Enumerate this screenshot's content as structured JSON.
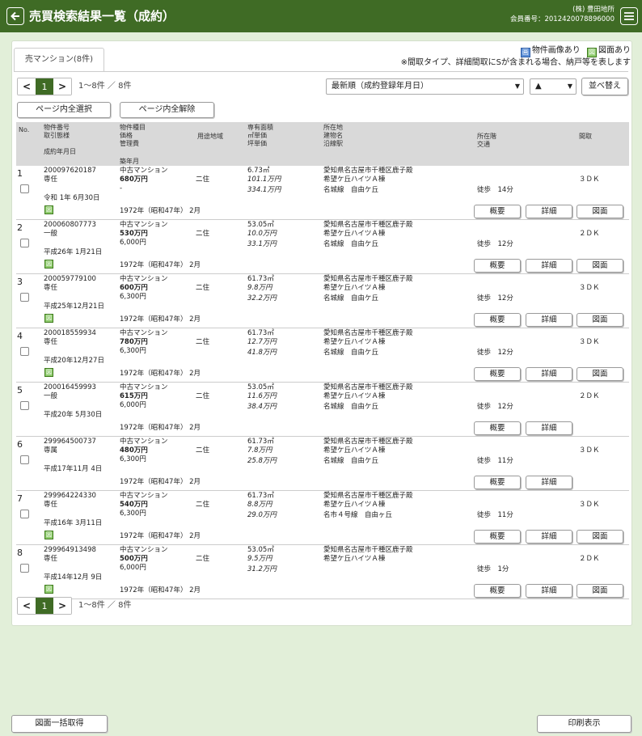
{
  "header": {
    "title": "売買検索結果一覧（成約）",
    "company": "(株) 豊田地所",
    "member_no": "会員番号：2012420078896000"
  },
  "tab": {
    "label": "売マンション(8件)"
  },
  "legend": {
    "photo_label": "物件画像あり",
    "plan_label": "図面あり",
    "note": "※間取タイプ、詳細間取にSが含まれる場合、納戸等を表します",
    "photo_icon": "画",
    "plan_icon": "図"
  },
  "pager": {
    "prev": "<",
    "current": "1",
    "next": ">",
    "range": "1～8件 ／ 8件"
  },
  "sort": {
    "selected": "最新順（成約登録年月日）",
    "direction": "▲",
    "button": "並べ替え"
  },
  "buttons": {
    "select_all": "ページ内全選択",
    "clear_all": "ページ内全解除"
  },
  "table_headers": {
    "no": "No.",
    "col1": [
      "物件番号",
      "取引態様",
      "",
      "成約年月日"
    ],
    "col2": [
      "物件種目",
      "価格",
      "管理費",
      "",
      "",
      "築年月"
    ],
    "col3": [
      "用途地域"
    ],
    "col4": [
      "専有面積",
      "㎡単価",
      "坪単価"
    ],
    "col5": [
      "所在地",
      "建物名",
      "沿線駅"
    ],
    "col6": [
      "所在階",
      "交通"
    ],
    "col7": [
      "間取"
    ]
  },
  "row_buttons": {
    "summary": "概要",
    "detail": "詳細",
    "plan": "図面"
  },
  "rows": [
    {
      "no": "1",
      "id": "200097620187",
      "mode": "専任",
      "date": "令和 1年 6月30日",
      "type": "中古マンション",
      "price": "680万円",
      "fee": "-",
      "built": "1972年（昭和47年） 2月",
      "zone": "二住",
      "area": "6.73㎡",
      "m2price": "101.1万円",
      "tsubo": "334.1万円",
      "addr": "愛知県名古屋市千種区鹿子殿",
      "bldg": "希望ケ丘ハイツＡ棟",
      "line": "名城線　自由ケ丘",
      "access": "徒歩　14分",
      "layout": "３ＤＫ",
      "plan": true
    },
    {
      "no": "2",
      "id": "200060807773",
      "mode": "一般",
      "date": "平成26年 1月21日",
      "type": "中古マンション",
      "price": "530万円",
      "fee": "6,000円",
      "built": "1972年（昭和47年） 2月",
      "zone": "二住",
      "area": "53.05㎡",
      "m2price": "10.0万円",
      "tsubo": "33.1万円",
      "addr": "愛知県名古屋市千種区鹿子殿",
      "bldg": "希望ケ丘ハイツＡ棟",
      "line": "名城線　自由ケ丘",
      "access": "徒歩　12分",
      "layout": "２ＤＫ",
      "plan": true
    },
    {
      "no": "3",
      "id": "200059779100",
      "mode": "専任",
      "date": "平成25年12月21日",
      "type": "中古マンション",
      "price": "600万円",
      "fee": "6,300円",
      "built": "1972年（昭和47年） 2月",
      "zone": "二住",
      "area": "61.73㎡",
      "m2price": "9.8万円",
      "tsubo": "32.2万円",
      "addr": "愛知県名古屋市千種区鹿子殿",
      "bldg": "希望ケ丘ハイツＡ棟",
      "line": "名城線　自由ケ丘",
      "access": "徒歩　12分",
      "layout": "３ＤＫ",
      "plan": true
    },
    {
      "no": "4",
      "id": "200018559934",
      "mode": "専任",
      "date": "平成20年12月27日",
      "type": "中古マンション",
      "price": "780万円",
      "fee": "6,300円",
      "built": "1972年（昭和47年） 2月",
      "zone": "二住",
      "area": "61.73㎡",
      "m2price": "12.7万円",
      "tsubo": "41.8万円",
      "addr": "愛知県名古屋市千種区鹿子殿",
      "bldg": "希望ケ丘ハイツＡ棟",
      "line": "名城線　自由ケ丘",
      "access": "徒歩　12分",
      "layout": "３ＤＫ",
      "plan": true
    },
    {
      "no": "5",
      "id": "200016459993",
      "mode": "一般",
      "date": "平成20年 5月30日",
      "type": "中古マンション",
      "price": "615万円",
      "fee": "6,000円",
      "built": "1972年（昭和47年） 2月",
      "zone": "二住",
      "area": "53.05㎡",
      "m2price": "11.6万円",
      "tsubo": "38.4万円",
      "addr": "愛知県名古屋市千種区鹿子殿",
      "bldg": "希望ケ丘ハイツＡ棟",
      "line": "名城線　自由ケ丘",
      "access": "徒歩　12分",
      "layout": "２ＤＫ",
      "plan": false
    },
    {
      "no": "6",
      "id": "299964500737",
      "mode": "専属",
      "date": "平成17年11月 4日",
      "type": "中古マンション",
      "price": "480万円",
      "fee": "6,300円",
      "built": "1972年（昭和47年） 2月",
      "zone": "二住",
      "area": "61.73㎡",
      "m2price": "7.8万円",
      "tsubo": "25.8万円",
      "addr": "愛知県名古屋市千種区鹿子殿",
      "bldg": "希望ケ丘ハイツＡ棟",
      "line": "名城線　自由ケ丘",
      "access": "徒歩　11分",
      "layout": "３ＤＫ",
      "plan": false
    },
    {
      "no": "7",
      "id": "299964224330",
      "mode": "専任",
      "date": "平成16年 3月11日",
      "type": "中古マンション",
      "price": "540万円",
      "fee": "6,300円",
      "built": "1972年（昭和47年） 2月",
      "zone": "二住",
      "area": "61.73㎡",
      "m2price": "8.8万円",
      "tsubo": "29.0万円",
      "addr": "愛知県名古屋市千種区鹿子殿",
      "bldg": "希望ケ丘ハイツＡ棟",
      "line": "名市４号線　自由ヶ丘",
      "access": "徒歩　11分",
      "layout": "３ＤＫ",
      "plan": true
    },
    {
      "no": "8",
      "id": "299964913498",
      "mode": "専任",
      "date": "平成14年12月 9日",
      "type": "中古マンション",
      "price": "500万円",
      "fee": "6,000円",
      "built": "1972年（昭和47年） 2月",
      "zone": "二住",
      "area": "53.05㎡",
      "m2price": "9.5万円",
      "tsubo": "31.2万円",
      "addr": "愛知県名古屋市千種区鹿子殿",
      "bldg": "希望ケ丘ハイツＡ棟",
      "line": "",
      "access": "徒歩　1分",
      "layout": "２ＤＫ",
      "plan": true
    }
  ],
  "footer": {
    "bulk_plan": "図面一括取得",
    "print": "印刷表示"
  }
}
